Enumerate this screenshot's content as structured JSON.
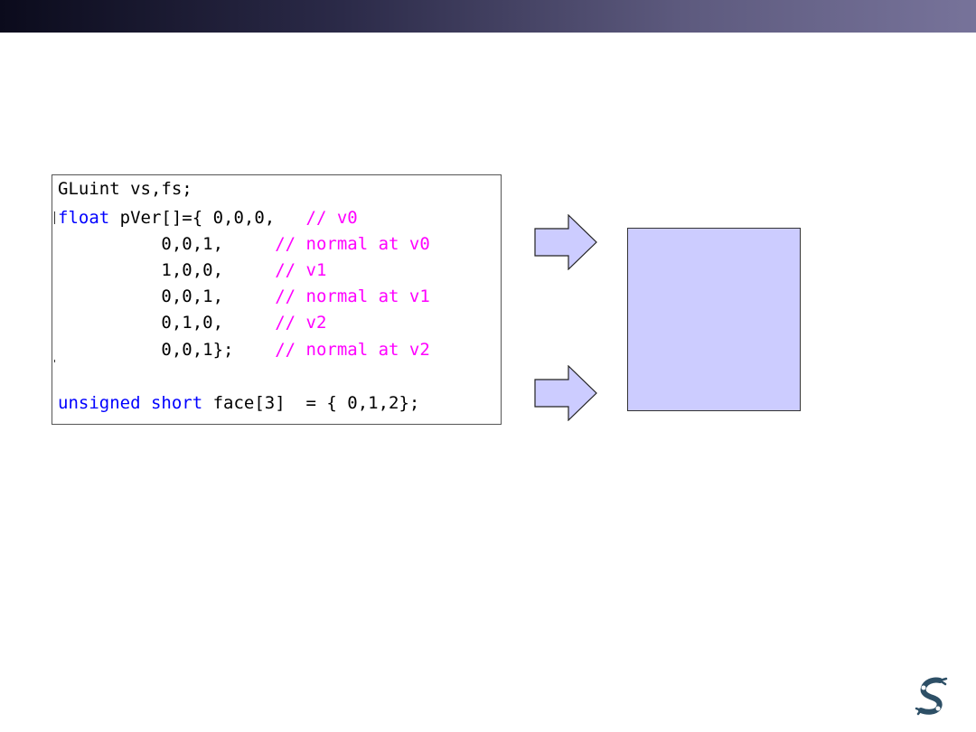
{
  "code": {
    "lines": [
      {
        "pre": "GLuint vs,fs;",
        "kw": "",
        "text": "",
        "comment": ""
      },
      {
        "pre": "",
        "kw": "float",
        "text": " pVer[]={ 0,0,0,   ",
        "comment": "// v0"
      },
      {
        "pre": "",
        "kw": "",
        "text": "          0,0,1,     ",
        "comment": "// normal at v0"
      },
      {
        "pre": "",
        "kw": "",
        "text": "          1,0,0,     ",
        "comment": "// v1"
      },
      {
        "pre": "",
        "kw": "",
        "text": "          0,0,1,     ",
        "comment": "// normal at v1"
      },
      {
        "pre": "",
        "kw": "",
        "text": "          0,1,0,     ",
        "comment": "// v2"
      },
      {
        "pre": "",
        "kw": "",
        "text": "          0,0,1};    ",
        "comment": "// normal at v2"
      },
      {
        "pre": "",
        "kw": "unsigned short",
        "text": " face[3]  = { 0,1,2};",
        "comment": ""
      }
    ]
  },
  "colors": {
    "keyword": "#0000ff",
    "comment": "#ff00ff",
    "arrow_fill": "#ccccff",
    "target_fill": "#ccccff"
  },
  "icons": {
    "logo": "robot-arm-logo"
  }
}
